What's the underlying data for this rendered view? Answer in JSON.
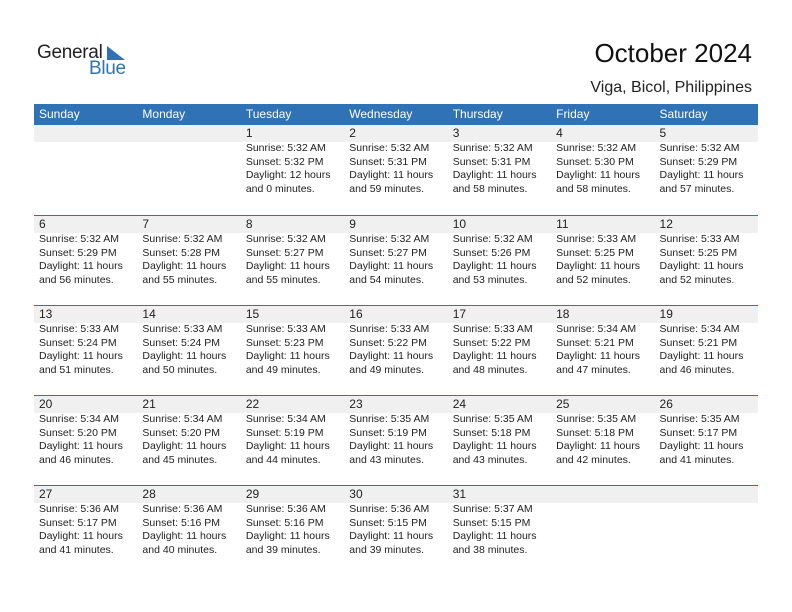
{
  "logo": {
    "word1": "General",
    "word2": "Blue"
  },
  "header": {
    "title": "October 2024",
    "location": "Viga, Bicol, Philippines"
  },
  "colors": {
    "accent": "#2f73b6",
    "date_bar": "#f0f0f0"
  },
  "weekdays": [
    "Sunday",
    "Monday",
    "Tuesday",
    "Wednesday",
    "Thursday",
    "Friday",
    "Saturday"
  ],
  "weeks": [
    [
      null,
      null,
      {
        "day": "1",
        "sunrise": "Sunrise: 5:32 AM",
        "sunset": "Sunset: 5:32 PM",
        "daylight1": "Daylight: 12 hours",
        "daylight2": "and 0 minutes."
      },
      {
        "day": "2",
        "sunrise": "Sunrise: 5:32 AM",
        "sunset": "Sunset: 5:31 PM",
        "daylight1": "Daylight: 11 hours",
        "daylight2": "and 59 minutes."
      },
      {
        "day": "3",
        "sunrise": "Sunrise: 5:32 AM",
        "sunset": "Sunset: 5:31 PM",
        "daylight1": "Daylight: 11 hours",
        "daylight2": "and 58 minutes."
      },
      {
        "day": "4",
        "sunrise": "Sunrise: 5:32 AM",
        "sunset": "Sunset: 5:30 PM",
        "daylight1": "Daylight: 11 hours",
        "daylight2": "and 58 minutes."
      },
      {
        "day": "5",
        "sunrise": "Sunrise: 5:32 AM",
        "sunset": "Sunset: 5:29 PM",
        "daylight1": "Daylight: 11 hours",
        "daylight2": "and 57 minutes."
      }
    ],
    [
      {
        "day": "6",
        "sunrise": "Sunrise: 5:32 AM",
        "sunset": "Sunset: 5:29 PM",
        "daylight1": "Daylight: 11 hours",
        "daylight2": "and 56 minutes."
      },
      {
        "day": "7",
        "sunrise": "Sunrise: 5:32 AM",
        "sunset": "Sunset: 5:28 PM",
        "daylight1": "Daylight: 11 hours",
        "daylight2": "and 55 minutes."
      },
      {
        "day": "8",
        "sunrise": "Sunrise: 5:32 AM",
        "sunset": "Sunset: 5:27 PM",
        "daylight1": "Daylight: 11 hours",
        "daylight2": "and 55 minutes."
      },
      {
        "day": "9",
        "sunrise": "Sunrise: 5:32 AM",
        "sunset": "Sunset: 5:27 PM",
        "daylight1": "Daylight: 11 hours",
        "daylight2": "and 54 minutes."
      },
      {
        "day": "10",
        "sunrise": "Sunrise: 5:32 AM",
        "sunset": "Sunset: 5:26 PM",
        "daylight1": "Daylight: 11 hours",
        "daylight2": "and 53 minutes."
      },
      {
        "day": "11",
        "sunrise": "Sunrise: 5:33 AM",
        "sunset": "Sunset: 5:25 PM",
        "daylight1": "Daylight: 11 hours",
        "daylight2": "and 52 minutes."
      },
      {
        "day": "12",
        "sunrise": "Sunrise: 5:33 AM",
        "sunset": "Sunset: 5:25 PM",
        "daylight1": "Daylight: 11 hours",
        "daylight2": "and 52 minutes."
      }
    ],
    [
      {
        "day": "13",
        "sunrise": "Sunrise: 5:33 AM",
        "sunset": "Sunset: 5:24 PM",
        "daylight1": "Daylight: 11 hours",
        "daylight2": "and 51 minutes."
      },
      {
        "day": "14",
        "sunrise": "Sunrise: 5:33 AM",
        "sunset": "Sunset: 5:24 PM",
        "daylight1": "Daylight: 11 hours",
        "daylight2": "and 50 minutes."
      },
      {
        "day": "15",
        "sunrise": "Sunrise: 5:33 AM",
        "sunset": "Sunset: 5:23 PM",
        "daylight1": "Daylight: 11 hours",
        "daylight2": "and 49 minutes."
      },
      {
        "day": "16",
        "sunrise": "Sunrise: 5:33 AM",
        "sunset": "Sunset: 5:22 PM",
        "daylight1": "Daylight: 11 hours",
        "daylight2": "and 49 minutes."
      },
      {
        "day": "17",
        "sunrise": "Sunrise: 5:33 AM",
        "sunset": "Sunset: 5:22 PM",
        "daylight1": "Daylight: 11 hours",
        "daylight2": "and 48 minutes."
      },
      {
        "day": "18",
        "sunrise": "Sunrise: 5:34 AM",
        "sunset": "Sunset: 5:21 PM",
        "daylight1": "Daylight: 11 hours",
        "daylight2": "and 47 minutes."
      },
      {
        "day": "19",
        "sunrise": "Sunrise: 5:34 AM",
        "sunset": "Sunset: 5:21 PM",
        "daylight1": "Daylight: 11 hours",
        "daylight2": "and 46 minutes."
      }
    ],
    [
      {
        "day": "20",
        "sunrise": "Sunrise: 5:34 AM",
        "sunset": "Sunset: 5:20 PM",
        "daylight1": "Daylight: 11 hours",
        "daylight2": "and 46 minutes."
      },
      {
        "day": "21",
        "sunrise": "Sunrise: 5:34 AM",
        "sunset": "Sunset: 5:20 PM",
        "daylight1": "Daylight: 11 hours",
        "daylight2": "and 45 minutes."
      },
      {
        "day": "22",
        "sunrise": "Sunrise: 5:34 AM",
        "sunset": "Sunset: 5:19 PM",
        "daylight1": "Daylight: 11 hours",
        "daylight2": "and 44 minutes."
      },
      {
        "day": "23",
        "sunrise": "Sunrise: 5:35 AM",
        "sunset": "Sunset: 5:19 PM",
        "daylight1": "Daylight: 11 hours",
        "daylight2": "and 43 minutes."
      },
      {
        "day": "24",
        "sunrise": "Sunrise: 5:35 AM",
        "sunset": "Sunset: 5:18 PM",
        "daylight1": "Daylight: 11 hours",
        "daylight2": "and 43 minutes."
      },
      {
        "day": "25",
        "sunrise": "Sunrise: 5:35 AM",
        "sunset": "Sunset: 5:18 PM",
        "daylight1": "Daylight: 11 hours",
        "daylight2": "and 42 minutes."
      },
      {
        "day": "26",
        "sunrise": "Sunrise: 5:35 AM",
        "sunset": "Sunset: 5:17 PM",
        "daylight1": "Daylight: 11 hours",
        "daylight2": "and 41 minutes."
      }
    ],
    [
      {
        "day": "27",
        "sunrise": "Sunrise: 5:36 AM",
        "sunset": "Sunset: 5:17 PM",
        "daylight1": "Daylight: 11 hours",
        "daylight2": "and 41 minutes."
      },
      {
        "day": "28",
        "sunrise": "Sunrise: 5:36 AM",
        "sunset": "Sunset: 5:16 PM",
        "daylight1": "Daylight: 11 hours",
        "daylight2": "and 40 minutes."
      },
      {
        "day": "29",
        "sunrise": "Sunrise: 5:36 AM",
        "sunset": "Sunset: 5:16 PM",
        "daylight1": "Daylight: 11 hours",
        "daylight2": "and 39 minutes."
      },
      {
        "day": "30",
        "sunrise": "Sunrise: 5:36 AM",
        "sunset": "Sunset: 5:15 PM",
        "daylight1": "Daylight: 11 hours",
        "daylight2": "and 39 minutes."
      },
      {
        "day": "31",
        "sunrise": "Sunrise: 5:37 AM",
        "sunset": "Sunset: 5:15 PM",
        "daylight1": "Daylight: 11 hours",
        "daylight2": "and 38 minutes."
      },
      null,
      null
    ]
  ]
}
